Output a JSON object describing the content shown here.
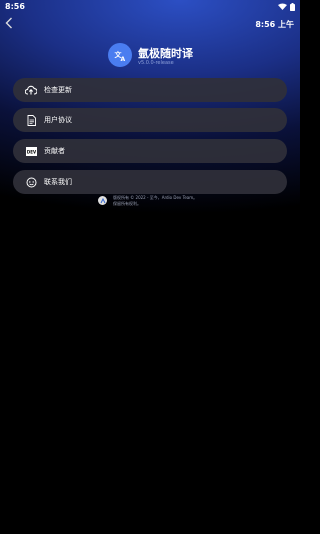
{
  "status_bar": {
    "time": "8:56"
  },
  "header": {
    "clock": "8:56 上午"
  },
  "app": {
    "title": "氩极随时译",
    "version": "v5.0.0-release"
  },
  "menu": [
    {
      "label": "检查更新",
      "icon": "cloud-upload-icon"
    },
    {
      "label": "用户协议",
      "icon": "document-icon"
    },
    {
      "label": "贡献者",
      "icon": "dev-icon",
      "icon_text": "DEV"
    },
    {
      "label": "联系我们",
      "icon": "chat-icon"
    }
  ],
  "footer": {
    "line1": "版权所有 © 2022 - 至今，Ardio Dev Team。",
    "line2": "保留所有权利。"
  },
  "colors": {
    "accent": "#4a7df0",
    "item_bg": "#30303a"
  }
}
